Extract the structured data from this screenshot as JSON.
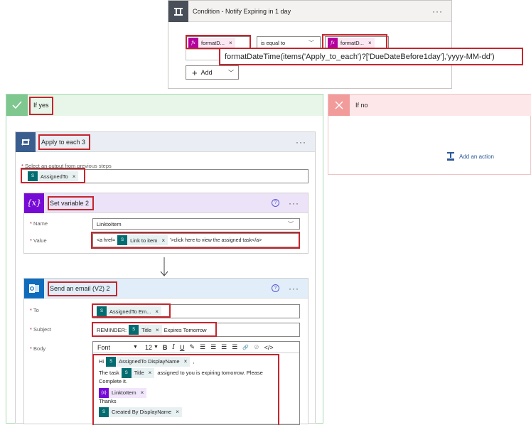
{
  "condition": {
    "title": "Condition - Notify Expiring in 1 day",
    "more": "···",
    "left_token": "formatD...",
    "operator": "is equal to",
    "right_token": "formatD...",
    "expression": "formatDateTime(items('Apply_to_each')?['DueDateBefore1day'],'yyyy-MM-dd')",
    "add_label": "Add",
    "add_icon": "+"
  },
  "if_yes": {
    "label": "If yes"
  },
  "if_no": {
    "label": "If no",
    "add_action": "Add an action"
  },
  "apply_each": {
    "title": "Apply to each 3",
    "more": "···",
    "select_label": "Select an output from previous steps",
    "token": "AssignedTo"
  },
  "set_variable": {
    "title": "Set variable 2",
    "icon": "{x}",
    "help": "?",
    "more": "···",
    "name_label": "Name",
    "name_value": "LinktoItem",
    "value_label": "Value",
    "value_prefix": "<a href=",
    "value_token": "Link to item",
    "value_suffix": "'>click here to view the assigned task</a>"
  },
  "send_email": {
    "title": "Send an email (V2) 2",
    "help": "?",
    "more": "···",
    "to_label": "To",
    "to_token": "AssignedTo Em...",
    "subject_label": "Subject",
    "subject_prefix": "REMINDER:",
    "subject_token": "Title",
    "subject_suffix": "Expires Tomorrow",
    "body_label": "Body",
    "font": "Font",
    "font_size": "12",
    "toolbar": [
      "B",
      "I",
      "U",
      "✎",
      "☰",
      "☰",
      "☰",
      "☰",
      "🔗",
      "⊘",
      "</>"
    ],
    "body": {
      "hi": "Hi",
      "display_name_token": "AssignedTo DisplayName",
      "comma": ",",
      "task_prefix": "The task",
      "title_token": "Title",
      "task_suffix": "assigned to you is expiring tomorrow. Please",
      "complete": "Complete it.",
      "link_token": "LinktoItem",
      "thanks": "Thanks",
      "created_by_token": "Created By DisplayName"
    }
  },
  "colors": {
    "condition_icon": "#484f58",
    "yes_green": "#2f9e44",
    "no_red": "#e57373",
    "apply_blue": "#3a5d8f",
    "variable_purple": "#770bd6",
    "outlook_blue": "#0f6cbd",
    "sharepoint_teal": "#036c70",
    "highlight_red": "#c4262e"
  }
}
